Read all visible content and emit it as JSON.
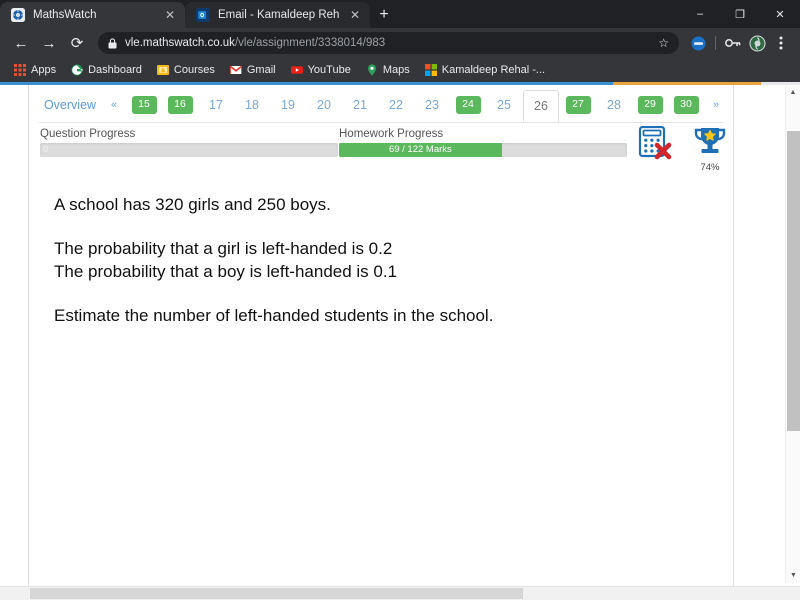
{
  "browser": {
    "tabs": [
      {
        "title": "MathsWatch",
        "favicon": "mathswatch-icon",
        "active": true,
        "close_label": "✕"
      },
      {
        "title": "Email - Kamaldeep Rehal - Outlo",
        "favicon": "outlook-icon",
        "active": false,
        "close_label": "✕"
      }
    ],
    "new_tab_label": "+",
    "window_controls": {
      "minimize": "–",
      "maximize": "❐",
      "close": "✕"
    },
    "nav": {
      "back": "←",
      "forward": "→",
      "reload": "⟳"
    },
    "omnibox": {
      "lock_icon": "padlock-icon",
      "url_domain": "vle.mathswatch.co.uk",
      "url_path": "/vle/assignment/3338014/983",
      "star_icon": "☆"
    },
    "toolbar_icons": [
      "profile-circle-icon",
      "key-icon",
      "avatar-icon",
      "kebab-menu-icon"
    ],
    "bookmarks": [
      {
        "label": "Apps",
        "icon": "apps-grid-icon"
      },
      {
        "label": "Dashboard",
        "icon": "google-g-icon"
      },
      {
        "label": "Courses",
        "icon": "classroom-icon"
      },
      {
        "label": "Gmail",
        "icon": "gmail-icon"
      },
      {
        "label": "YouTube",
        "icon": "youtube-icon"
      },
      {
        "label": "Maps",
        "icon": "maps-pin-icon"
      },
      {
        "label": "Kamaldeep Rehal -...",
        "icon": "microsoft-icon"
      }
    ]
  },
  "page": {
    "pagination": {
      "overview_label": "Overview",
      "prev_label": "«",
      "next_label": "»",
      "items": [
        {
          "label": "15",
          "state": "complete"
        },
        {
          "label": "16",
          "state": "complete"
        },
        {
          "label": "17",
          "state": "normal"
        },
        {
          "label": "18",
          "state": "normal"
        },
        {
          "label": "19",
          "state": "normal"
        },
        {
          "label": "20",
          "state": "normal"
        },
        {
          "label": "21",
          "state": "normal"
        },
        {
          "label": "22",
          "state": "normal"
        },
        {
          "label": "23",
          "state": "normal"
        },
        {
          "label": "24",
          "state": "complete"
        },
        {
          "label": "25",
          "state": "normal"
        },
        {
          "label": "26",
          "state": "active"
        },
        {
          "label": "27",
          "state": "complete"
        },
        {
          "label": "28",
          "state": "normal"
        },
        {
          "label": "29",
          "state": "complete"
        },
        {
          "label": "30",
          "state": "complete"
        }
      ]
    },
    "question_progress": {
      "label": "Question Progress",
      "value_label": "0",
      "percent": 0
    },
    "homework_progress": {
      "label": "Homework Progress",
      "value_label": "69 / 122 Marks",
      "percent": 56.5
    },
    "calculator": {
      "icon": "calculator-not-allowed-icon"
    },
    "trophy": {
      "icon": "trophy-star-icon",
      "percent_label": "74%"
    },
    "question": {
      "line1": "A school has 320 girls and 250 boys.",
      "line2": "The probability that a girl is left-handed is 0.2",
      "line3": "The probability that a boy is left-handed is 0.1",
      "line4": "Estimate the number of left-handed students in the school."
    }
  },
  "colors": {
    "green": "#5cb85c",
    "link_blue": "#7aa8d4",
    "load_blue": "#3a8fd0",
    "load_orange": "#e8a33d",
    "red_x": "#d3242a",
    "icon_blue": "#1f6fb5"
  }
}
